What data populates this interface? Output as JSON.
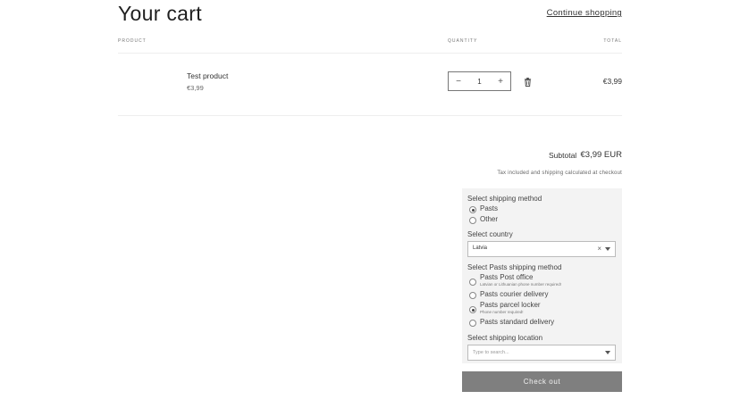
{
  "header": {
    "title": "Your cart",
    "continue_label": "Continue shopping"
  },
  "table": {
    "col_product": "PRODUCT",
    "col_quantity": "QUANTITY",
    "col_total": "TOTAL"
  },
  "item": {
    "name": "Test product",
    "price": "€3,99",
    "quantity": "1",
    "line_total": "€3,99"
  },
  "summary": {
    "subtotal_label": "Subtotal",
    "subtotal_value": "€3,99 EUR",
    "tax_note": "Tax included and shipping calculated at checkout"
  },
  "shipping": {
    "method_title": "Select shipping method",
    "methods": [
      {
        "label": "Pasts",
        "selected": true
      },
      {
        "label": "Other",
        "selected": false
      }
    ],
    "country_title": "Select country",
    "country_value": "Latvia",
    "pasts_title": "Select Pasts shipping method",
    "pasts_options": [
      {
        "label": "Pasts Post office",
        "sub": "Latvian or Lithuanian phone number required!",
        "selected": false
      },
      {
        "label": "Pasts courier delivery",
        "sub": "",
        "selected": false
      },
      {
        "label": "Pasts parcel locker",
        "sub": "Phone number required!",
        "selected": true
      },
      {
        "label": "Pasts standard delivery",
        "sub": "",
        "selected": false
      }
    ],
    "location_title": "Select shipping location",
    "location_placeholder": "Type to search..."
  },
  "checkout_label": "Check out"
}
